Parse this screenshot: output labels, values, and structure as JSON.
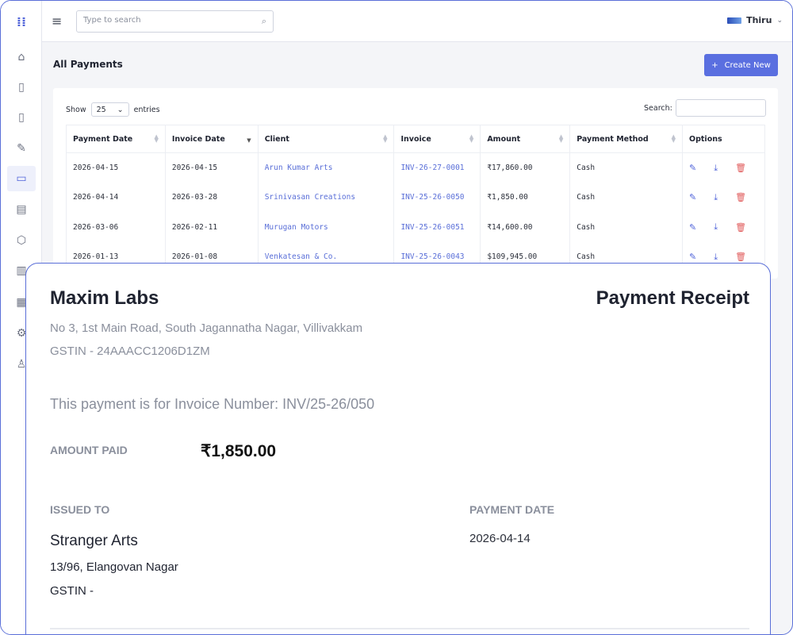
{
  "topbar": {
    "search_placeholder": "Type to search",
    "user_name": "Thiru"
  },
  "page": {
    "title": "All Payments",
    "create_label": "Create New"
  },
  "table_controls": {
    "show_label": "Show",
    "entries_value": "25",
    "entries_label": "entries",
    "search_label": "Search:"
  },
  "table": {
    "columns": [
      "Payment Date",
      "Invoice Date",
      "Client",
      "Invoice",
      "Amount",
      "Payment Method",
      "Options"
    ],
    "rows": [
      {
        "payment_date": "2026-04-15",
        "invoice_date": "2026-04-15",
        "client": "Arun Kumar Arts",
        "invoice": "INV-26-27-0001",
        "amount": "₹17,860.00",
        "method": "Cash"
      },
      {
        "payment_date": "2026-04-14",
        "invoice_date": "2026-03-28",
        "client": "Srinivasan Creations",
        "invoice": "INV-25-26-0050",
        "amount": "₹1,850.00",
        "method": "Cash"
      },
      {
        "payment_date": "2026-03-06",
        "invoice_date": "2026-02-11",
        "client": "Murugan Motors",
        "invoice": "INV-25-26-0051",
        "amount": "₹14,600.00",
        "method": "Cash"
      },
      {
        "payment_date": "2026-01-13",
        "invoice_date": "2026-01-08",
        "client": "Venkatesan & Co.",
        "invoice": "INV-25-26-0043",
        "amount": "$109,945.00",
        "method": "Cash"
      }
    ]
  },
  "receipt": {
    "company_name": "Maxim Labs",
    "title": "Payment Receipt",
    "company_address": "No 3, 1st Main Road, South Jagannatha Nagar, Villivakkam",
    "company_gstin": "GSTIN - 24AAACC1206D1ZM",
    "invoice_line": "This payment is for Invoice Number: INV/25-26/050",
    "amount_label": "AMOUNT PAID",
    "amount_value": "₹1,850.00",
    "issued_label": "ISSUED TO",
    "payment_date_label": "PAYMENT DATE",
    "client_name": "Stranger Arts",
    "payment_date_value": "2026-04-14",
    "client_address": "13/96, Elangovan Nagar",
    "client_gstin": "GSTIN -"
  },
  "icons": {
    "logo": "grid-dots-icon",
    "sidebar": [
      "home-icon",
      "bookmark-icon",
      "bookmark-icon",
      "edit-document-icon",
      "payment-card-icon",
      "card-icon",
      "box-icon",
      "chart-icon",
      "report-icon",
      "settings-icon",
      "user-icon"
    ]
  },
  "colors": {
    "accent": "#5a6fe0",
    "link": "#5a6fd8",
    "delete": "#e05a5a"
  }
}
